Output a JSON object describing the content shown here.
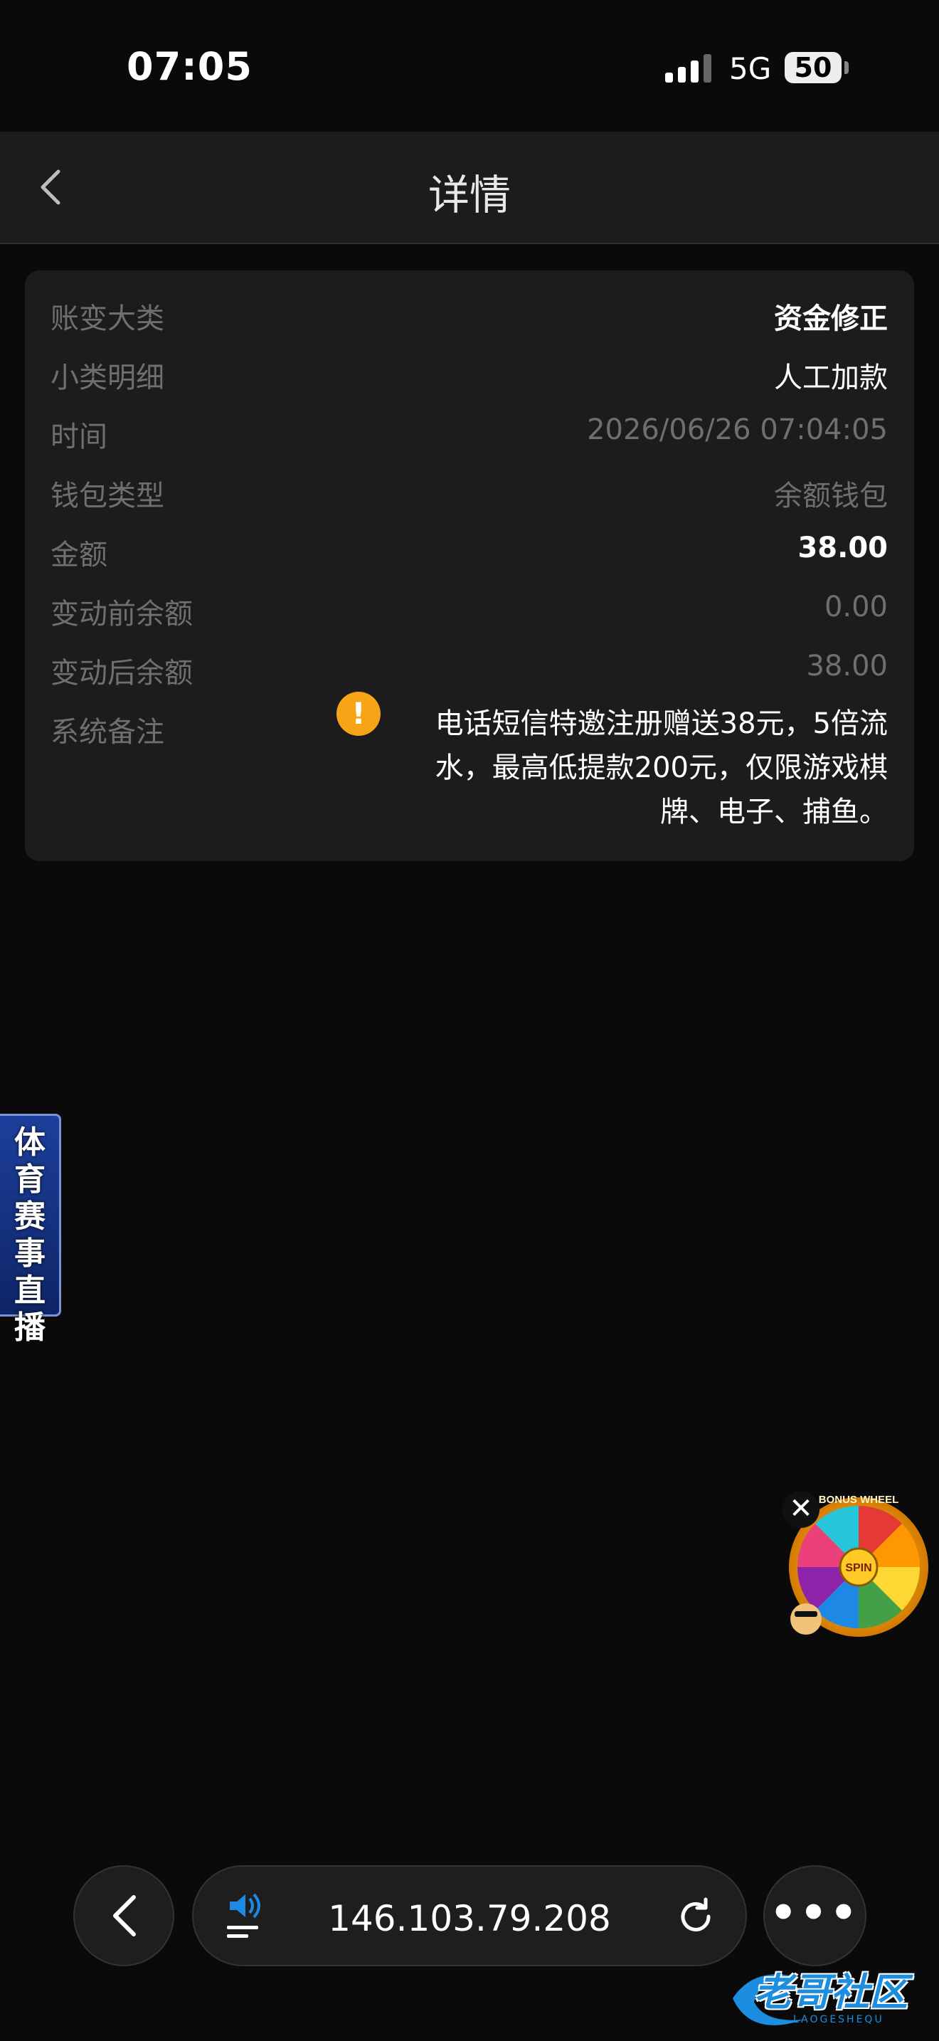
{
  "status_bar": {
    "time": "07:05",
    "network": "5G",
    "battery": "50"
  },
  "header": {
    "title": "详情"
  },
  "detail": {
    "rows": [
      {
        "label": "账变大类",
        "value": "资金修正"
      },
      {
        "label": "小类明细",
        "value": "人工加款"
      },
      {
        "label": "时间",
        "value": "2026/06/26 07:04:05"
      },
      {
        "label": "钱包类型",
        "value": "余额钱包"
      },
      {
        "label": "金额",
        "value": "38.00"
      },
      {
        "label": "变动前余额",
        "value": "0.00"
      },
      {
        "label": "变动后余额",
        "value": "38.00"
      }
    ],
    "note_label": "系统备注",
    "note_icon": "!",
    "note_lines": [
      "电话短信特邀注册赠送38元，5倍流",
      "水，最高低提款200元，仅限游戏棋",
      "牌、电子、捕鱼。"
    ]
  },
  "promo": {
    "sports_banner": "体育赛事直播",
    "wheel_top": "BONUS WHEEL",
    "wheel_center": "SPIN",
    "close": "✕"
  },
  "browser": {
    "address": "146.103.79.208"
  },
  "watermark": {
    "text": "老哥社区",
    "sub": "LAOGESHEQU"
  },
  "colors": {
    "background": "#0a0a0a",
    "card": "#1c1c1c",
    "accent_warning": "#f7a517",
    "label_grey": "#6f6f6f"
  },
  "icons": [
    "signal-icon",
    "back-chevron-icon",
    "warning-icon",
    "speaker-icon",
    "reload-icon",
    "more-icon"
  ]
}
